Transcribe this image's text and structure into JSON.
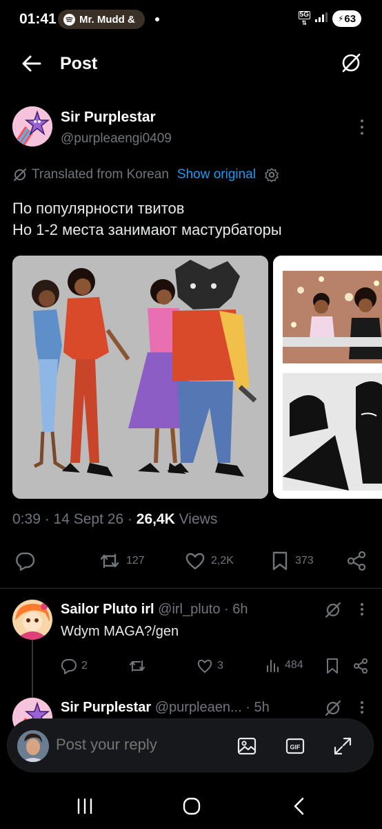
{
  "status": {
    "time": "01:41",
    "media_text": "Mr. Mudd &",
    "network": "5G",
    "battery": "63"
  },
  "header": {
    "title": "Post"
  },
  "post": {
    "author_name": "Sir Purplestar",
    "author_handle": "@purpleaengi0409",
    "translated_label": "Translated from Korean",
    "show_original": "Show original",
    "text_line1": "По популярности твитов",
    "text_line2": "Но 1-2 места занимают мастурбаторы",
    "timestamp": "0:39 · 14 Sept 26 · ",
    "views_count": "26,4K",
    "views_label": " Views",
    "reposts": "127",
    "likes": "2,2K",
    "bookmarks": "373"
  },
  "replies": [
    {
      "name": "Sailor Pluto irl",
      "handle": " @irl_pluto · 6h",
      "text": "Wdym MAGA?/gen",
      "replies": "2",
      "likes": "3",
      "views": "484"
    },
    {
      "name": "Sir Purplestar",
      "handle": " @purpleaen... · 5h"
    }
  ],
  "composer": {
    "placeholder": "Post your reply"
  },
  "colors": {
    "accent": "#1d9bf0",
    "muted": "#71767b",
    "background": "#000000"
  }
}
